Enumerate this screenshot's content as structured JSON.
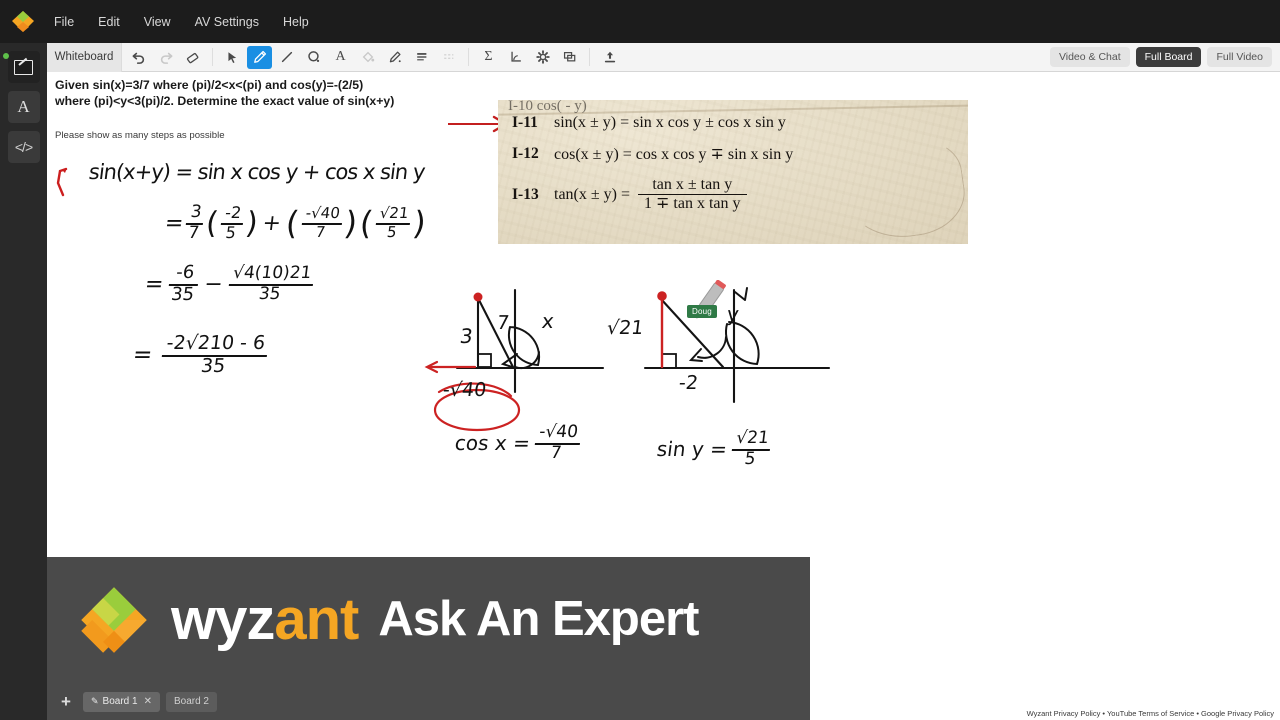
{
  "app": {
    "logo_name": "wyzant-diamond-logo",
    "brand_colors": {
      "orange": "#f5a623",
      "green": "#9acd3c",
      "dark": "#4a4a4a",
      "accent_blue": "#1a8fe3"
    }
  },
  "menubar": {
    "items": [
      {
        "label": "File",
        "name": "menu-file"
      },
      {
        "label": "Edit",
        "name": "menu-edit"
      },
      {
        "label": "View",
        "name": "menu-view"
      },
      {
        "label": "AV Settings",
        "name": "menu-av-settings"
      },
      {
        "label": "Help",
        "name": "menu-help"
      }
    ]
  },
  "left_rail": {
    "items": [
      {
        "icon": "whiteboard-icon",
        "label": "Whiteboard",
        "active": true,
        "status": "online"
      },
      {
        "icon": "text-document-icon",
        "label": "A"
      },
      {
        "icon": "code-icon",
        "label": "</>"
      }
    ]
  },
  "toolbar": {
    "tab_label": "Whiteboard",
    "tools": [
      {
        "name": "undo-icon",
        "glyph": "↶",
        "state": "enabled"
      },
      {
        "name": "redo-icon",
        "glyph": "↷",
        "state": "disabled"
      },
      {
        "name": "eraser-icon",
        "glyph": "▱",
        "state": "enabled"
      },
      {
        "name": "select-cursor-icon",
        "glyph": "➤",
        "state": "enabled"
      },
      {
        "name": "pencil-icon",
        "glyph": "✎",
        "state": "active"
      },
      {
        "name": "line-icon",
        "glyph": "╱",
        "state": "enabled"
      },
      {
        "name": "shape-circle-icon",
        "glyph": "◯",
        "state": "enabled"
      },
      {
        "name": "text-tool-icon",
        "glyph": "A",
        "state": "enabled"
      },
      {
        "name": "fill-bucket-icon",
        "glyph": "◇",
        "state": "disabled"
      },
      {
        "name": "highlighter-icon",
        "glyph": "✐",
        "state": "enabled"
      },
      {
        "name": "line-weight-icon",
        "glyph": "≡",
        "state": "enabled"
      },
      {
        "name": "line-style-icon",
        "glyph": "≣",
        "state": "disabled"
      },
      {
        "name": "math-sigma-icon",
        "glyph": "Σ",
        "state": "enabled"
      },
      {
        "name": "graph-axis-icon",
        "glyph": "┗",
        "state": "enabled"
      },
      {
        "name": "settings-gear-icon",
        "glyph": "⚙",
        "state": "enabled"
      },
      {
        "name": "layers-icon",
        "glyph": "⧉",
        "state": "enabled"
      },
      {
        "name": "upload-icon",
        "glyph": "↥",
        "state": "enabled"
      }
    ],
    "view_buttons": [
      {
        "label": "Video & Chat",
        "name": "view-video-chat",
        "active": false
      },
      {
        "label": "Full Board",
        "name": "view-full-board",
        "active": true
      },
      {
        "label": "Full Video",
        "name": "view-full-video",
        "active": false
      }
    ]
  },
  "canvas": {
    "problem_title": "Given sin(x)=3/7 where (pi)/2<x<(pi) and cos(y)=-(2/5) where (pi)<y<3(pi)/2. Determine the exact value of sin(x+y)",
    "problem_subtitle": "Please show as many steps as possible",
    "formula_photo": {
      "clipped_top_row": "I-10   cos(  - y)",
      "rows": [
        {
          "id": "I-11",
          "body": "sin(x ± y) = sin x cos y ± cos x sin y"
        },
        {
          "id": "I-12",
          "body": "cos(x ± y) = cos x cos y ∓ sin x sin y"
        },
        {
          "id": "I-13",
          "body": "tan(x ± y) =",
          "num": "tan x ± tan y",
          "den": "1 ∓ tan x tan y"
        }
      ]
    },
    "handwriting": {
      "line1": "sin(x+y) = sin x cos y + cos x sin y",
      "line2_lead": "=",
      "line2_a_num": "3",
      "line2_a_den": "7",
      "line2_b_num": "-2",
      "line2_b_den": "5",
      "line2_plus": "+",
      "line2_c_num": "-√40",
      "line2_c_den": "7",
      "line2_d_num": "√21",
      "line2_d_den": "5",
      "line3_lead": "=",
      "line3_a_num": "-6",
      "line3_a_den": "35",
      "line3_minus": "−",
      "line3_b_num": "√4(10)21",
      "line3_b_den": "35",
      "line4_lead": "=",
      "line4_num": "-2√210 - 6",
      "line4_den": "35",
      "diagram1": {
        "opposite": "3",
        "hypotenuse": "7",
        "angle": "x",
        "adjacent": "-√40",
        "result": "cos x =",
        "result_num": "-√40",
        "result_den": "7"
      },
      "diagram2": {
        "opposite": "√21",
        "adjacent": "-2",
        "angle": "y",
        "result": "sin y =",
        "result_num": "√21",
        "result_den": "5"
      }
    },
    "remote_cursor": {
      "name": "Doug",
      "color": "#2f7a46",
      "tool": "pencil-cursor-icon"
    }
  },
  "branding": {
    "word_1": "wyz",
    "word_2": "ant",
    "tagline": "Ask An Expert"
  },
  "board_tabs": {
    "add_label": "+",
    "tabs": [
      {
        "label": "Board 1",
        "active": true,
        "closable": true
      },
      {
        "label": "Board 2",
        "active": false,
        "closable": false
      }
    ]
  },
  "footer": {
    "legal": "Wyzant Privacy Policy  •  YouTube Terms of Service  •  Google Privacy Policy"
  }
}
